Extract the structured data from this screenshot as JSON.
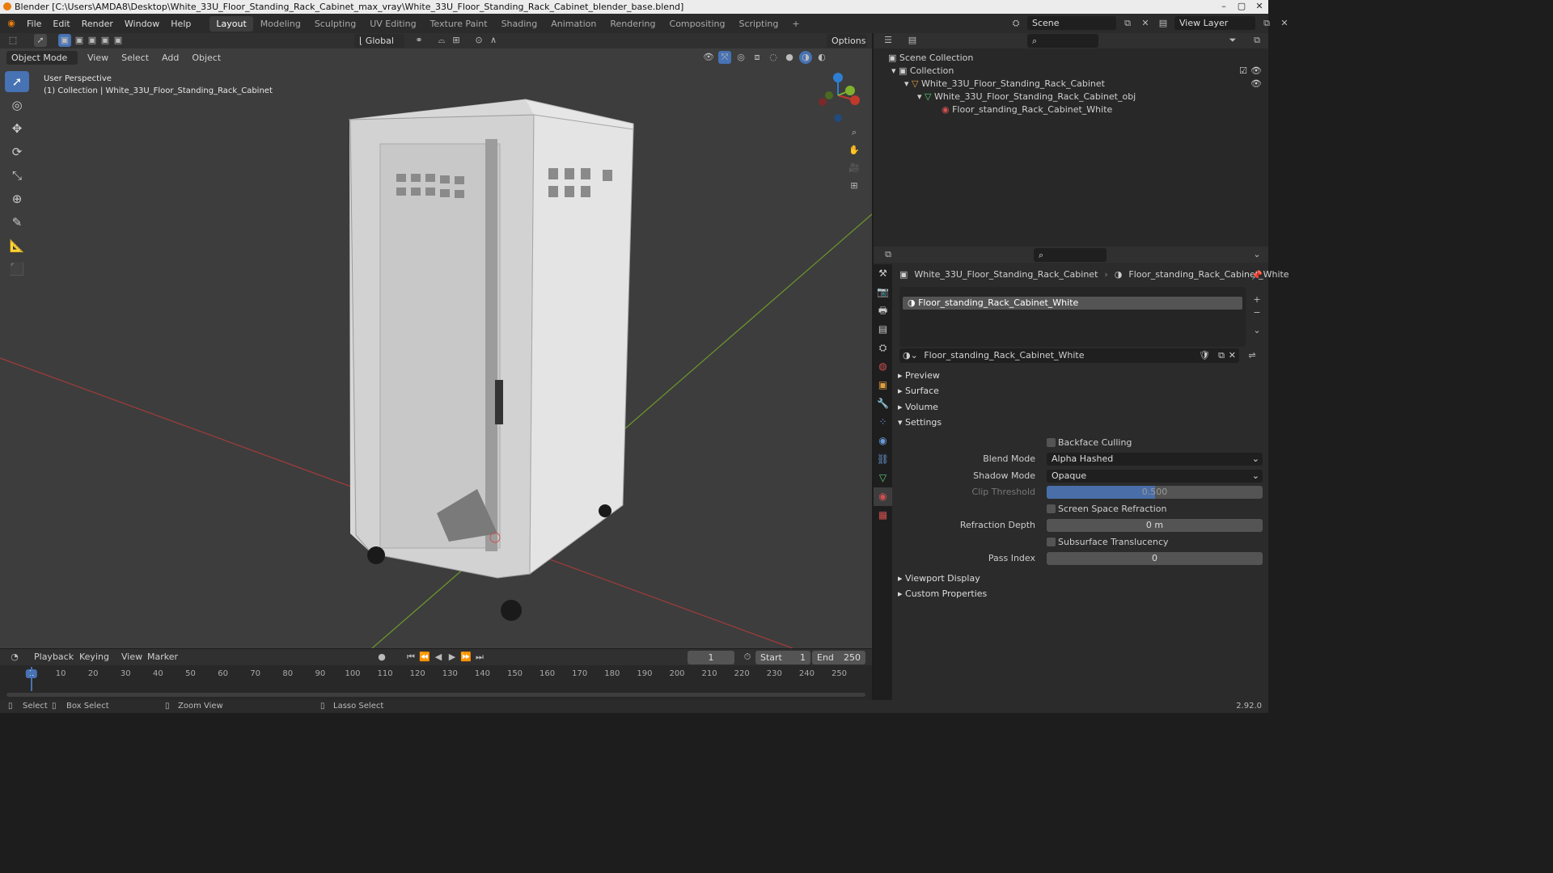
{
  "window": {
    "title": "Blender [C:\\Users\\AMDA8\\Desktop\\White_33U_Floor_Standing_Rack_Cabinet_max_vray\\White_33U_Floor_Standing_Rack_Cabinet_blender_base.blend]"
  },
  "menu": [
    "File",
    "Edit",
    "Render",
    "Window",
    "Help"
  ],
  "workspaces": [
    "Layout",
    "Modeling",
    "Sculpting",
    "UV Editing",
    "Texture Paint",
    "Shading",
    "Animation",
    "Rendering",
    "Compositing",
    "Scripting"
  ],
  "active_workspace": "Layout",
  "scene": {
    "name": "Scene",
    "view_layer": "View Layer"
  },
  "viewport": {
    "mode": "Object Mode",
    "menus": [
      "View",
      "Select",
      "Add",
      "Object"
    ],
    "orientation": "Global",
    "options_label": "Options",
    "perspective_label": "User Perspective",
    "collection_label": "(1) Collection | White_33U_Floor_Standing_Rack_Cabinet"
  },
  "outliner": {
    "scene_collection": "Scene Collection",
    "collection": "Collection",
    "object": "White_33U_Floor_Standing_Rack_Cabinet",
    "mesh": "White_33U_Floor_Standing_Rack_Cabinet_obj",
    "material": "Floor_standing_Rack_Cabinet_White"
  },
  "properties": {
    "breadcrumb_object": "White_33U_Floor_Standing_Rack_Cabinet",
    "breadcrumb_material": "Floor_standing_Rack_Cabinet_White",
    "slot_name": "Floor_standing_Rack_Cabinet_White",
    "material_name": "Floor_standing_Rack_Cabinet_White",
    "panels": {
      "preview": "Preview",
      "surface": "Surface",
      "volume": "Volume",
      "settings": "Settings",
      "viewport_display": "Viewport Display",
      "custom_properties": "Custom Properties"
    },
    "settings": {
      "backface_culling": "Backface Culling",
      "blend_mode_label": "Blend Mode",
      "blend_mode": "Alpha Hashed",
      "shadow_mode_label": "Shadow Mode",
      "shadow_mode": "Opaque",
      "clip_threshold_label": "Clip Threshold",
      "clip_threshold": "0.500",
      "clip_threshold_fraction": 0.5,
      "ssr_label": "Screen Space Refraction",
      "refraction_depth_label": "Refraction Depth",
      "refraction_depth": "0 m",
      "sss_label": "Subsurface Translucency",
      "pass_index_label": "Pass Index",
      "pass_index": "0"
    }
  },
  "timeline": {
    "menus": [
      "Playback",
      "Keying",
      "View",
      "Marker"
    ],
    "current_frame": "1",
    "start_label": "Start",
    "start": "1",
    "end_label": "End",
    "end": "250",
    "ticks": [
      "1",
      "10",
      "20",
      "30",
      "40",
      "50",
      "60",
      "70",
      "80",
      "90",
      "100",
      "110",
      "120",
      "130",
      "140",
      "150",
      "160",
      "170",
      "180",
      "190",
      "200",
      "210",
      "220",
      "230",
      "240",
      "250"
    ]
  },
  "status": {
    "select": "Select",
    "box_select": "Box Select",
    "zoom_view": "Zoom View",
    "lasso_select": "Lasso Select",
    "version": "2.92.0"
  },
  "colors": {
    "accent": "#4772b3",
    "x_axis": "#c0392b",
    "y_axis": "#7fb12d",
    "z_axis": "#2d7fd3"
  }
}
